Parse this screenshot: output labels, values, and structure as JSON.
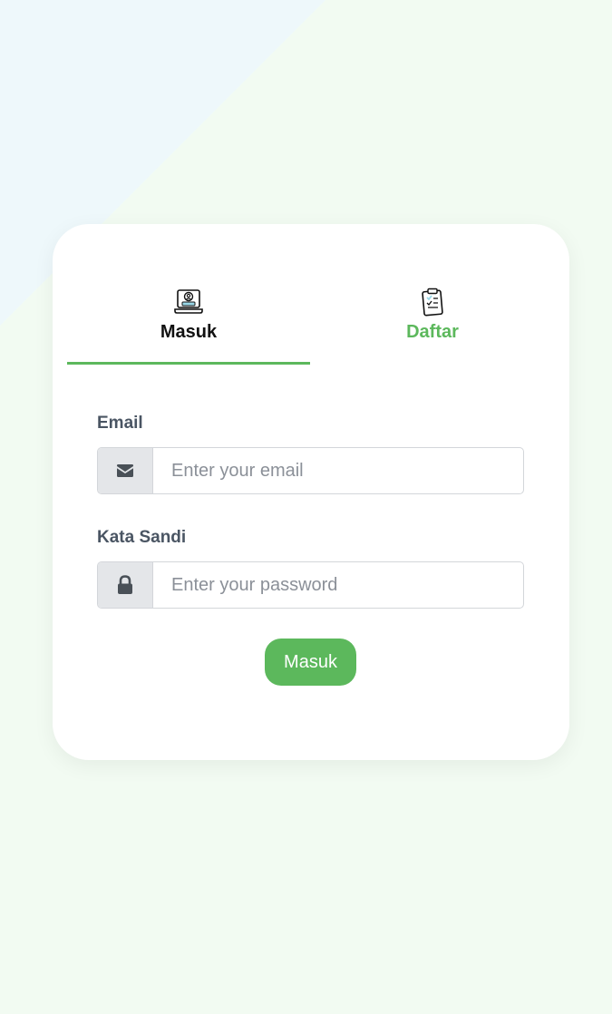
{
  "tabs": {
    "login_label": "Masuk",
    "register_label": "Daftar"
  },
  "form": {
    "email_label": "Email",
    "email_placeholder": "Enter your email",
    "password_label": "Kata Sandi",
    "password_placeholder": "Enter your password",
    "submit_label": "Masuk"
  },
  "icons": {
    "login_tab": "user-laptop-icon",
    "register_tab": "clipboard-icon",
    "email": "envelope-icon",
    "password": "lock-icon"
  },
  "colors": {
    "accent": "#5cb85c",
    "page_background": "#f2fbf2"
  }
}
